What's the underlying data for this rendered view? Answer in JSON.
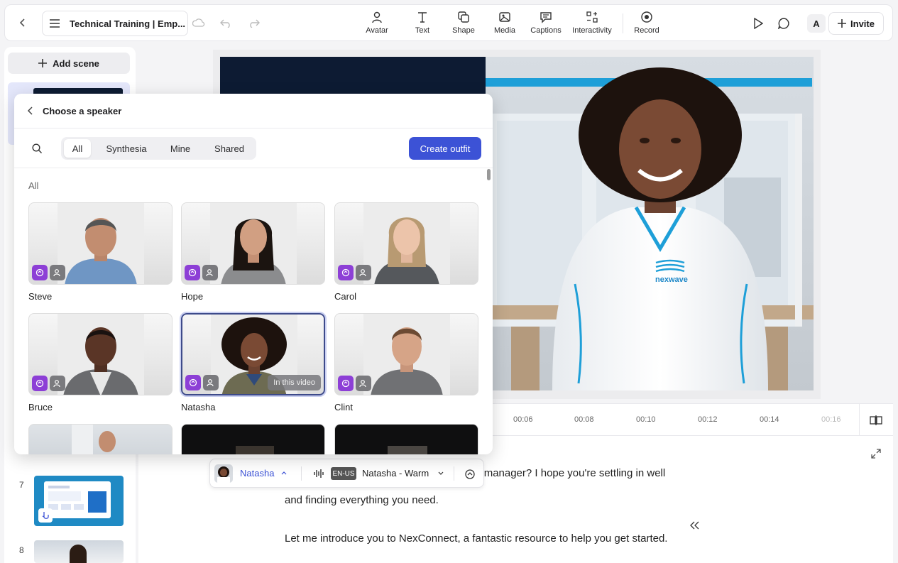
{
  "header": {
    "project_title": "Technical Training | Emp...",
    "tools": [
      {
        "label": "Avatar",
        "icon": "avatar-icon"
      },
      {
        "label": "Text",
        "icon": "text-icon"
      },
      {
        "label": "Shape",
        "icon": "shape-icon"
      },
      {
        "label": "Media",
        "icon": "media-icon"
      },
      {
        "label": "Captions",
        "icon": "captions-icon"
      },
      {
        "label": "Interactivity",
        "icon": "interactivity-icon"
      },
      {
        "label": "Record",
        "icon": "record-icon"
      }
    ],
    "user_initial": "A",
    "invite_label": "Invite"
  },
  "sidebar": {
    "add_scene_label": "Add scene",
    "scenes": [
      {
        "number": "7"
      },
      {
        "number": "8"
      }
    ]
  },
  "modal": {
    "title": "Choose a speaker",
    "filters": [
      "All",
      "Synthesia",
      "Mine",
      "Shared"
    ],
    "active_filter": "All",
    "create_label": "Create outfit",
    "section_label": "All",
    "avatars": [
      {
        "name": "Steve"
      },
      {
        "name": "Hope"
      },
      {
        "name": "Carol"
      },
      {
        "name": "Bruce"
      },
      {
        "name": "Natasha",
        "badge": "In this video"
      },
      {
        "name": "Clint"
      }
    ]
  },
  "timeline": {
    "ticks": [
      "00:06",
      "00:08",
      "00:10",
      "00:12",
      "00:14",
      "00:16"
    ]
  },
  "voicebar": {
    "avatar_name": "Natasha",
    "language": "EN-US",
    "voice": "Natasha - Warm"
  },
  "canvas": {
    "logo_text": "nexwave"
  },
  "script": {
    "line1": "cial media manager? I hope you're settling in well",
    "line2": "and finding everything you need.",
    "line3": "Let me introduce you to NexConnect, a fantastic resource to help you get started."
  }
}
